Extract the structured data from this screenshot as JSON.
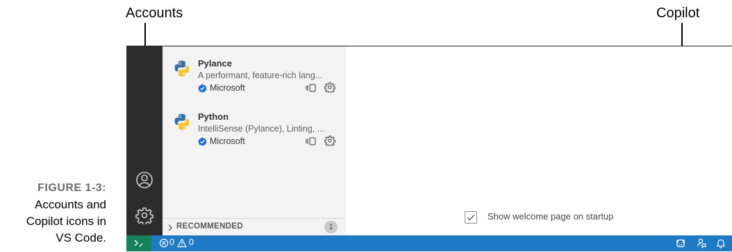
{
  "callouts": {
    "accounts": "Accounts",
    "copilot": "Copilot"
  },
  "caption": {
    "figure": "FIGURE 1-3:",
    "line1": "Accounts and",
    "line2": "Copilot icons in",
    "line3": "VS Code."
  },
  "extensions": [
    {
      "name": "Pylance",
      "description": "A performant, feature-rich lang...",
      "publisher": "Microsoft"
    },
    {
      "name": "Python",
      "description": "IntelliSense (Pylance), Linting, ...",
      "publisher": "Microsoft"
    }
  ],
  "recommended": {
    "label": "RECOMMENDED",
    "count": "1"
  },
  "welcome": {
    "checkbox_label": "Show welcome page on startup",
    "checked": true
  },
  "statusbar": {
    "errors": "0",
    "warnings": "0"
  },
  "colors": {
    "activity_bar": "#2c2c2c",
    "sidebar": "#f3f3f3",
    "statusbar": "#1f7ac6",
    "remote": "#16825d",
    "verified": "#1e6fd9"
  },
  "icons": [
    "accounts-icon",
    "manage-gear-icon",
    "python-logo-icon",
    "verified-icon",
    "sync-ignored-icon",
    "extension-gear-icon",
    "chevron-right-icon",
    "remote-icon",
    "error-icon",
    "warning-icon",
    "copilot-icon",
    "feedback-icon",
    "bell-icon"
  ]
}
